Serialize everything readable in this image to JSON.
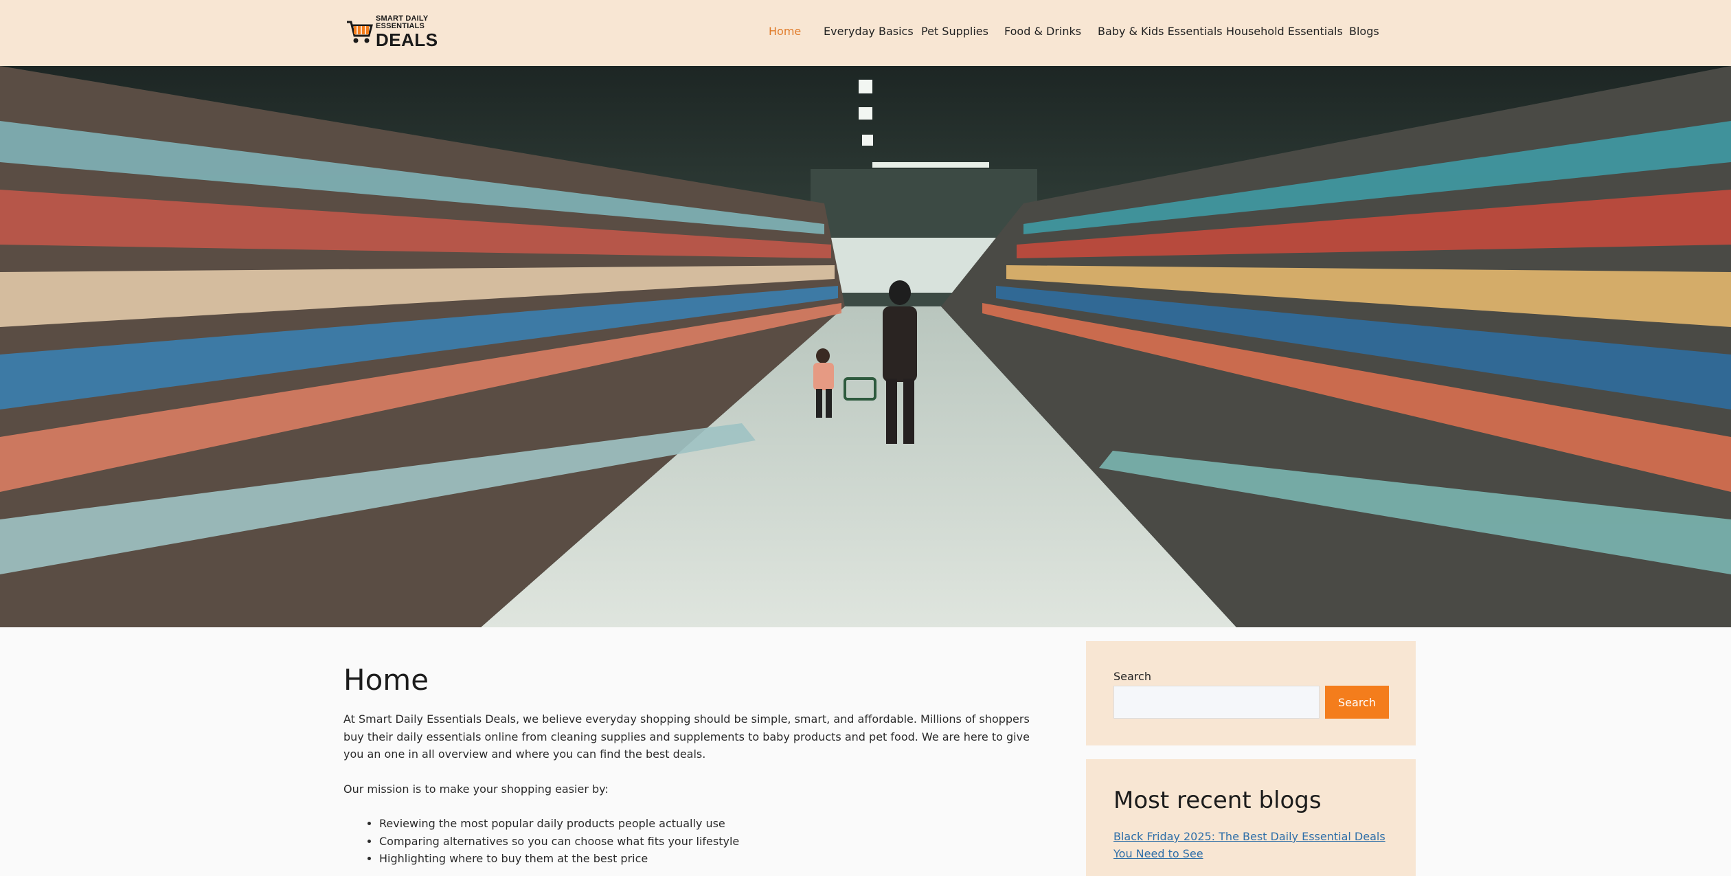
{
  "header": {
    "logo": {
      "line1": "SMART DAILY",
      "line2": "ESSENTIALS",
      "line3": "DEALS"
    },
    "nav": [
      {
        "label": "Home",
        "active": true
      },
      {
        "label": "Everyday Basics"
      },
      {
        "label": "Pet Supplies"
      },
      {
        "label": "Food & Drinks"
      },
      {
        "label": "Baby & Kids Essentials"
      },
      {
        "label": "Household Essentials"
      },
      {
        "label": "Blogs"
      }
    ]
  },
  "hero": {
    "image": "grocery-store-aisle-photo"
  },
  "main": {
    "title": "Home",
    "intro": "At Smart Daily Essentials Deals, we believe everyday shopping should be simple, smart, and affordable. Millions of shoppers buy their daily essentials online from cleaning supplies and supplements to baby products and pet food. We are here to give you an one in all overview and where you can find the best deals.",
    "mission": "Our mission is to make your shopping easier by:",
    "bullets": [
      "Reviewing the most popular daily products people actually use",
      "Comparing alternatives so you can choose what fits your lifestyle",
      "Highlighting where to buy them at the best price"
    ]
  },
  "sidebar": {
    "search": {
      "label": "Search",
      "placeholder": "",
      "button": "Search"
    },
    "recent": {
      "title": "Most recent blogs",
      "links": [
        "Black Friday 2025: The Best Daily Essential Deals You Need to See"
      ]
    }
  },
  "colors": {
    "header_bg": "#f8e6d3",
    "accent": "#f47d1c",
    "active_nav": "#e07b2a",
    "link": "#2f6fa8"
  }
}
